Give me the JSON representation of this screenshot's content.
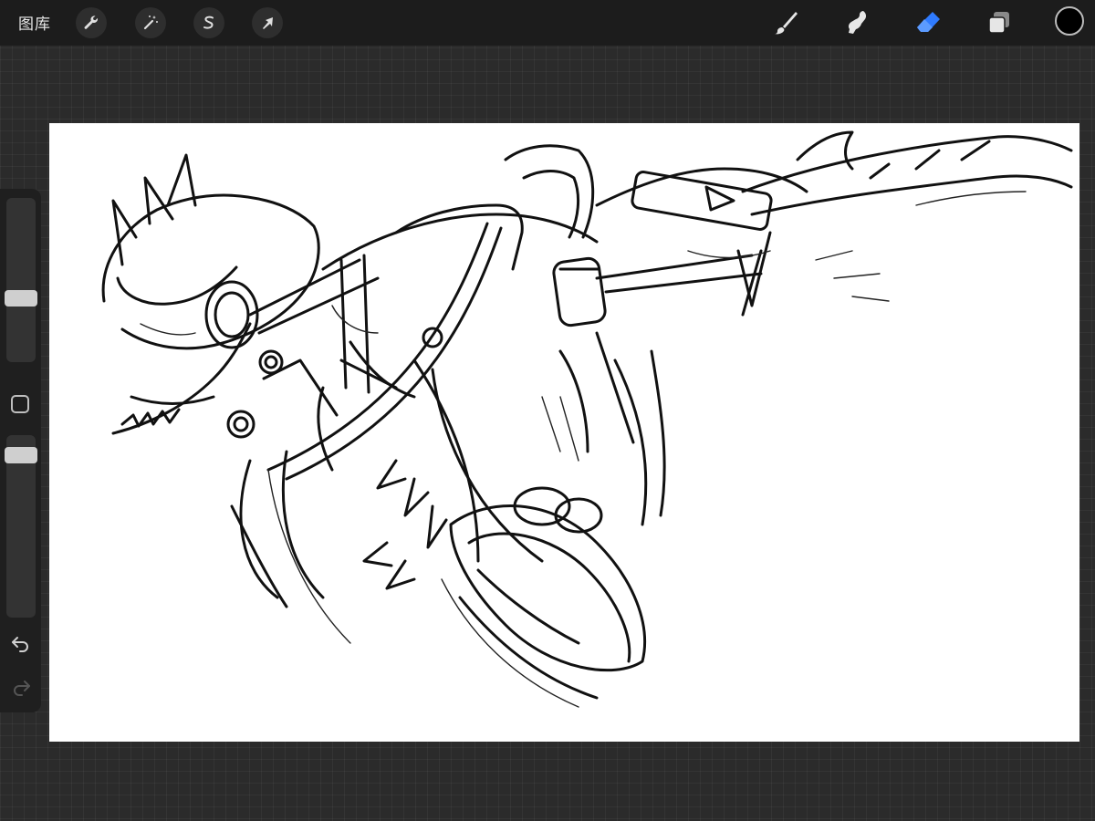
{
  "topbar": {
    "gallery_label": "图库",
    "left_tools": [
      {
        "name": "actions",
        "icon": "wrench-icon"
      },
      {
        "name": "adjustments",
        "icon": "magic-wand-icon"
      },
      {
        "name": "selection",
        "icon": "selection-s-icon"
      },
      {
        "name": "transform",
        "icon": "arrow-cursor-icon"
      }
    ],
    "right_tools": [
      {
        "name": "brush",
        "icon": "brush-icon",
        "active": false
      },
      {
        "name": "smudge",
        "icon": "smudge-icon",
        "active": false
      },
      {
        "name": "eraser",
        "icon": "eraser-icon",
        "active": true
      },
      {
        "name": "layers",
        "icon": "layers-icon",
        "active": false
      }
    ],
    "current_color": "#000000",
    "active_tool_color": "#2f7bff"
  },
  "sidebar": {
    "brush_size_level": 0.62,
    "opacity_level": 0.96,
    "buttons": [
      "modify-square-icon",
      "undo-icon",
      "redo-icon"
    ]
  },
  "canvas": {
    "background": "#ffffff",
    "content": "line-art-sketch"
  }
}
